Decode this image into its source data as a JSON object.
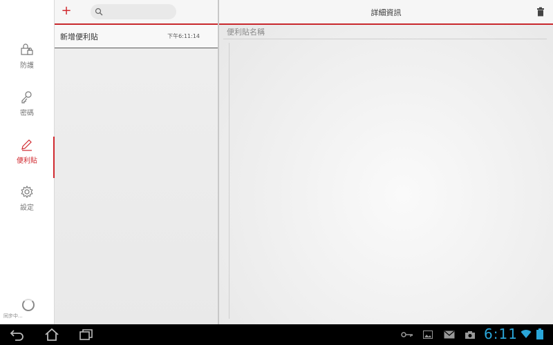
{
  "nav": {
    "items": [
      {
        "id": "protect",
        "label": "防護",
        "icon": "lock-icon"
      },
      {
        "id": "password",
        "label": "密碼",
        "icon": "key-icon"
      },
      {
        "id": "notes",
        "label": "便利貼",
        "icon": "pencil-icon",
        "active": true
      },
      {
        "id": "settings",
        "label": "設定",
        "icon": "gear-icon"
      }
    ],
    "sync_status": "同步中..."
  },
  "list": {
    "search_placeholder": "",
    "items": [
      {
        "title": "新增便利貼",
        "time": "下午6:11:14"
      }
    ]
  },
  "detail": {
    "title": "詳細資訊",
    "name_placeholder": "便利貼名稱",
    "body_value": ""
  },
  "system_bar": {
    "clock": "6:11",
    "tray_icons": [
      "key-icon",
      "image-icon",
      "mail-icon",
      "camera-icon",
      "wifi-icon",
      "battery-icon"
    ]
  },
  "colors": {
    "accent": "#d0282e",
    "clock": "#2aa6d9"
  }
}
